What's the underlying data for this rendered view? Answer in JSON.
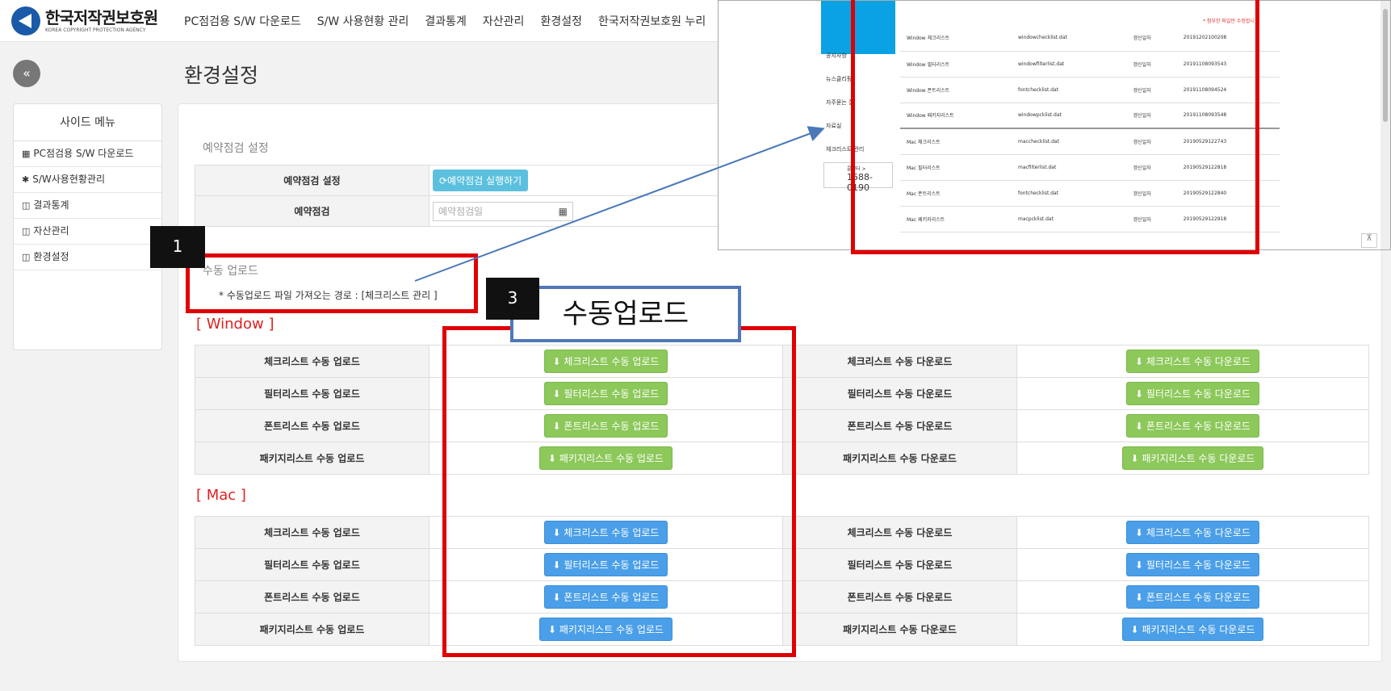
{
  "app": {
    "logo_ko": "한국저작권보호원",
    "logo_en": "KOREA COPYRIGHT PROTECTION AGENCY",
    "collapse_glyph": "«"
  },
  "nav": {
    "items": [
      "PC점검용 S/W 다운로드",
      "S/W 사용현황 관리",
      "결과통계",
      "자산관리",
      "환경설정",
      "한국저작권보호원 누리"
    ]
  },
  "page_title": "환경설정",
  "sidebar": {
    "title": "사이드 메뉴",
    "items": [
      {
        "icon": "▦",
        "label": "PC점검용 S/W 다운로드"
      },
      {
        "icon": "✱",
        "label": "S/W사용현황관리"
      },
      {
        "icon": "◫",
        "label": "결과통계"
      },
      {
        "icon": "◫",
        "label": "자산관리"
      },
      {
        "icon": "◫",
        "label": "환경설정"
      }
    ]
  },
  "reservation": {
    "section_title": "예약점검 설정",
    "row1_label": "예약점검 설정",
    "run_button": "⟳예약점검 실행하기",
    "row2_label": "예약점검",
    "date_placeholder": "예약점검일"
  },
  "manual": {
    "section_title": "수동 업로드",
    "note": "* 수동업로드 파일 가져오는 경로 : [체크리스트 관리 ]"
  },
  "window": {
    "title": "[ Window ]",
    "rows": [
      {
        "up_label": "체크리스트 수동 업로드",
        "up_btn": "⬇ 체크리스트 수동 업로드",
        "down_label": "체크리스트 수동 다운로드",
        "down_btn": "⬇ 체크리스트 수동 다운로드"
      },
      {
        "up_label": "필터리스트 수동 업로드",
        "up_btn": "⬇ 필터리스트 수동 업로드",
        "down_label": "필터리스트 수동 다운로드",
        "down_btn": "⬇ 필터리스트 수동 다운로드"
      },
      {
        "up_label": "폰트리스트 수동 업로드",
        "up_btn": "⬇ 폰트리스트 수동 업로드",
        "down_label": "폰트리스트 수동 다운로드",
        "down_btn": "⬇ 폰트리스트 수동 다운로드"
      },
      {
        "up_label": "패키지리스트 수동 업로드",
        "up_btn": "⬇ 패키지리스트 수동 업로드",
        "down_label": "패키지리스트 수동 다운로드",
        "down_btn": "⬇ 패키지리스트 수동 다운로드"
      }
    ]
  },
  "mac": {
    "title": "[ Mac ]",
    "rows": [
      {
        "up_label": "체크리스트 수동 업로드",
        "up_btn": "⬇ 체크리스트 수동 업로드",
        "down_label": "체크리스트 수동 다운로드",
        "down_btn": "⬇ 체크리스트 수동 다운로드"
      },
      {
        "up_label": "필터리스트 수동 업로드",
        "up_btn": "⬇ 필터리스트 수동 업로드",
        "down_label": "필터리스트 수동 다운로드",
        "down_btn": "⬇ 필터리스트 수동 다운로드"
      },
      {
        "up_label": "폰트리스트 수동 업로드",
        "up_btn": "⬇ 폰트리스트 수동 업로드",
        "down_label": "폰트리스트 수동 다운로드",
        "down_btn": "⬇ 폰트리스트 수동 다운로드"
      },
      {
        "up_label": "패키지리스트 수동 업로드",
        "up_btn": "⬇ 패키지리스트 수동 업로드",
        "down_label": "패키지리스트 수동 다운로드",
        "down_btn": "⬇ 패키지리스트 수동 다운로드"
      }
    ]
  },
  "inset": {
    "menu": [
      "공지사항",
      "뉴스클리핑",
      "자주묻는 질",
      "자료실",
      "체크리스트 관리"
    ],
    "center_label": "콜센터 >",
    "center_phone": "1588-0190",
    "note": "* 첨부한 파일만 수정합니",
    "rows": [
      [
        "Window 체크리스트",
        "windowchecklist.dat",
        "갱신일자",
        "20191202100208"
      ],
      [
        "Window 필터리스트",
        "windowfilterlist.dat",
        "갱신일자",
        "20191108093543"
      ],
      [
        "Window 폰트리스트",
        "fontchecklist.dat",
        "갱신일자",
        "20191108094524"
      ],
      [
        "Window 패키지리스트",
        "windowpcklist.dat",
        "갱신일자",
        "20191108093548"
      ],
      [
        "Mac 체크리스트",
        "macchecklist.dat",
        "갱신일자",
        "20190529122743"
      ],
      [
        "Mac 필터리스트",
        "macfilterlist.dat",
        "갱신일자",
        "20190529122818"
      ],
      [
        "Mac 폰트리스트",
        "fontchecklist.dat",
        "갱신일자",
        "20190529122840"
      ],
      [
        "Mac 패키지리스트",
        "macpcklist.dat",
        "갱신일자",
        "20190529122918"
      ]
    ],
    "top_btn": "⊼"
  },
  "annotations": {
    "badge1": "1",
    "badge3": "3",
    "callout": "수동업로드"
  }
}
